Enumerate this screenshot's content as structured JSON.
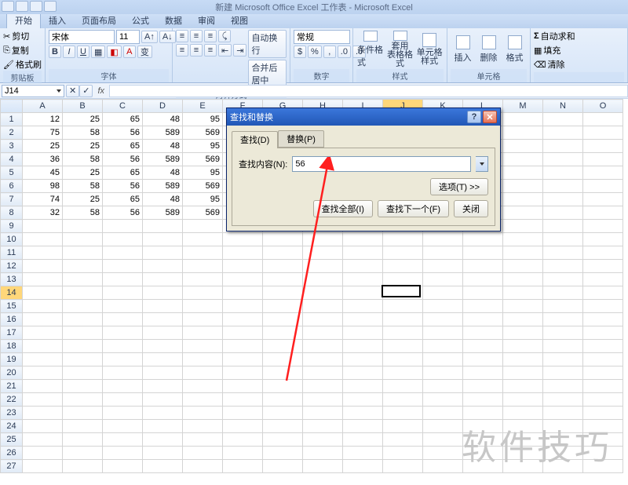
{
  "window_title": "新建 Microsoft Office Excel 工作表 - Microsoft Excel",
  "tabs": [
    "开始",
    "插入",
    "页面布局",
    "公式",
    "数据",
    "审阅",
    "视图"
  ],
  "active_tab": 0,
  "clipboard": {
    "cut": "剪切",
    "copy": "复制",
    "paint": "格式刷",
    "label": "剪贴板"
  },
  "font": {
    "name": "宋体",
    "size": "11",
    "label": "字体"
  },
  "align": {
    "wrap": "自动换行",
    "merge": "合并后居中",
    "label": "对齐方式"
  },
  "number": {
    "format": "常规",
    "label": "数字"
  },
  "styles": {
    "cond": "条件格式",
    "table": "套用\n表格格式",
    "cell": "单元格\n样式",
    "label": "样式"
  },
  "cellsg": {
    "insert": "插入",
    "delete": "删除",
    "format": "格式",
    "label": "单元格"
  },
  "edit": {
    "sum": "自动求和",
    "fill": "填充",
    "clear": "清除",
    "label": ""
  },
  "namebox": "J14",
  "columns": [
    "A",
    "B",
    "C",
    "D",
    "E",
    "F",
    "G",
    "H",
    "I",
    "J",
    "K",
    "L",
    "M",
    "N",
    "O"
  ],
  "row_count": 27,
  "active_col": 9,
  "cells": [
    [
      "12",
      "25",
      "65",
      "48",
      "95"
    ],
    [
      "75",
      "58",
      "56",
      "589",
      "569"
    ],
    [
      "25",
      "25",
      "65",
      "48",
      "95"
    ],
    [
      "36",
      "58",
      "56",
      "589",
      "569"
    ],
    [
      "45",
      "25",
      "65",
      "48",
      "95"
    ],
    [
      "98",
      "58",
      "56",
      "589",
      "569"
    ],
    [
      "74",
      "25",
      "65",
      "48",
      "95"
    ],
    [
      "32",
      "58",
      "56",
      "589",
      "569"
    ]
  ],
  "selected_cell": {
    "row": 14,
    "col": 9
  },
  "dialog": {
    "title": "查找和替换",
    "tab_find": "查找(D)",
    "tab_replace": "替换(P)",
    "find_label": "查找内容(N):",
    "find_value": "56",
    "options": "选项(T) >>",
    "find_all": "查找全部(I)",
    "find_next": "查找下一个(F)",
    "close": "关闭"
  },
  "watermark": "软件技巧"
}
